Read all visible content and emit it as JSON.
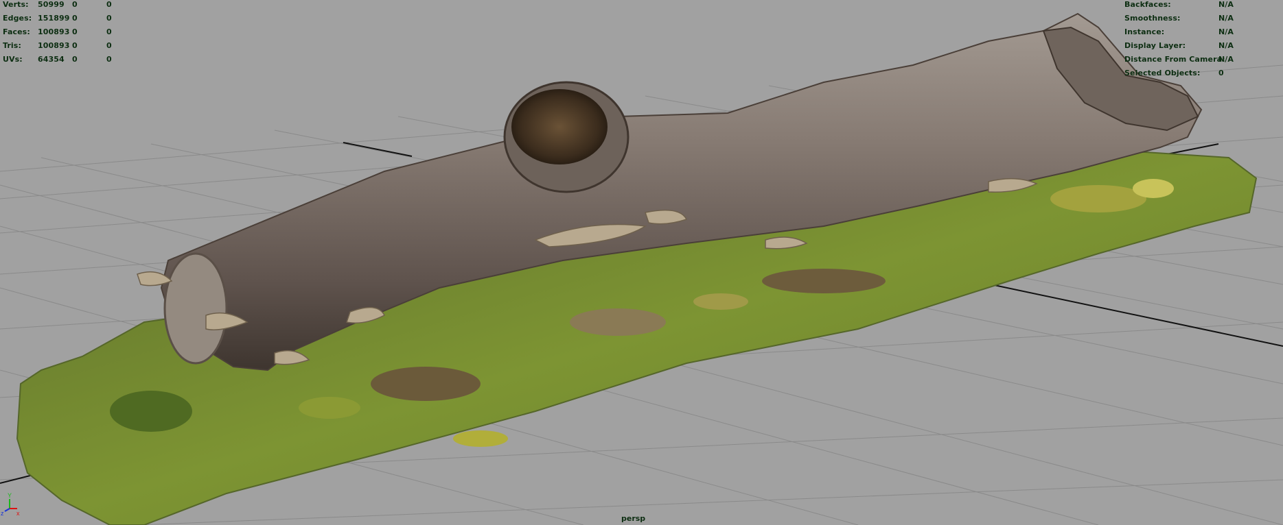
{
  "hud_left": {
    "rows": [
      {
        "label": "Verts:",
        "total": "50999",
        "selected": "0",
        "components": "0"
      },
      {
        "label": "Edges:",
        "total": "151899",
        "selected": "0",
        "components": "0"
      },
      {
        "label": "Faces:",
        "total": "100893",
        "selected": "0",
        "components": "0"
      },
      {
        "label": "Tris:",
        "total": "100893",
        "selected": "0",
        "components": "0"
      },
      {
        "label": "UVs:",
        "total": "64354",
        "selected": "0",
        "components": "0"
      }
    ]
  },
  "hud_right": {
    "rows": [
      {
        "label": "Backfaces:",
        "value": "N/A"
      },
      {
        "label": "Smoothness:",
        "value": "N/A"
      },
      {
        "label": "Instance:",
        "value": "N/A"
      },
      {
        "label": "Display Layer:",
        "value": "N/A"
      },
      {
        "label": "Distance From Camera:",
        "value": "N/A"
      },
      {
        "label": "Selected Objects:",
        "value": "0"
      }
    ]
  },
  "camera": {
    "name": "persp"
  },
  "axis_gizmo": {
    "x_label": "x",
    "y_label": "Y",
    "z_label": "z"
  },
  "colors": {
    "viewport_bg": "#a1a1a1",
    "grid_line": "#888888",
    "grid_axis": "#111111",
    "hud_text": "#0d2e12",
    "bark": "#7e7168",
    "moss": "#6f8a2c"
  }
}
